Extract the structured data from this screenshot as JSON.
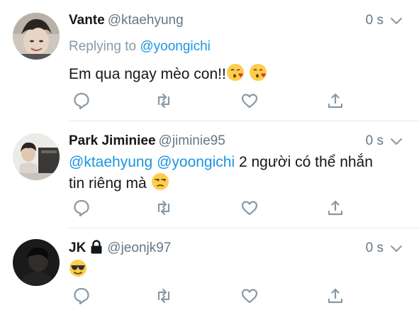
{
  "colors": {
    "accent": "#1b95e0",
    "secondary_text": "#657786",
    "icon": "#8899a6",
    "divider": "#e1e8ed"
  },
  "tweets": [
    {
      "display_name": "Vante",
      "handle": "@ktaehyung",
      "time": "0 s",
      "replying_prefix": "Replying to ",
      "replying_handle": "@yoongichi",
      "text": "Em qua ngay mèo con!!",
      "emojis": [
        "kissing-face-heart-emoji",
        "kissing-face-heart-emoji"
      ]
    },
    {
      "display_name": "Park Jiminiee",
      "handle": "@jiminie95",
      "time": "0 s",
      "mention_1": "@ktaehyung",
      "mention_2": "@yoongichi",
      "text_line1_rest": " 2 người có thể nhắn",
      "text_line2": "tin riêng mà ",
      "emojis": [
        "unamused-face-emoji"
      ]
    },
    {
      "display_name": "JK",
      "handle": "@jeonjk97",
      "time": "0 s",
      "locked": true,
      "emojis": [
        "sunglasses-face-emoji"
      ]
    }
  ]
}
